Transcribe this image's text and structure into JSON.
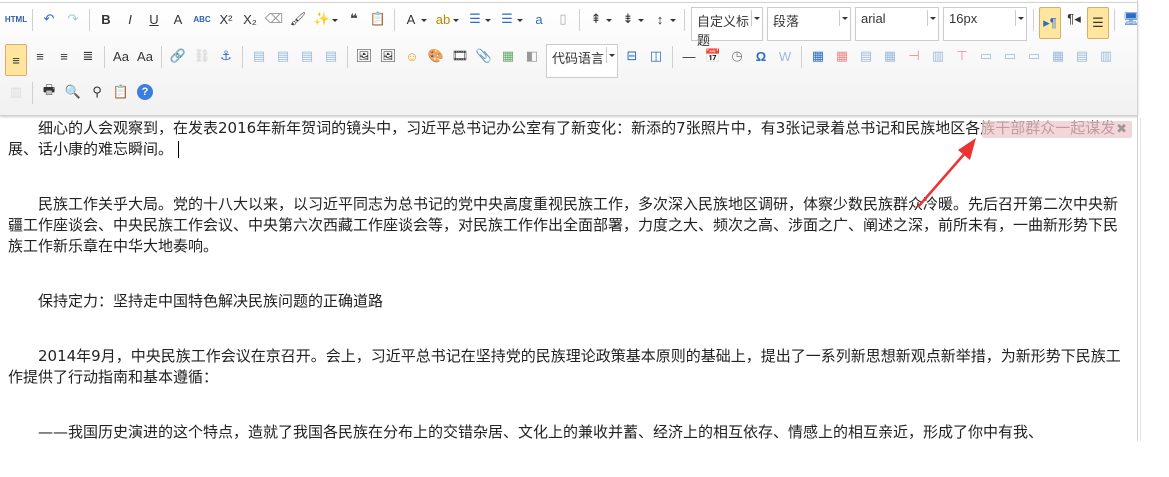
{
  "toolbar": {
    "row1": [
      {
        "icon": "html-source-icon",
        "g": "HTML",
        "small": true
      },
      {
        "sep": 1
      },
      {
        "icon": "undo-icon",
        "g": "↶",
        "c": "#2b6cc4"
      },
      {
        "icon": "redo-icon",
        "g": "↷",
        "c": "#9cc"
      },
      {
        "sep": 1
      },
      {
        "icon": "bold-icon",
        "g": "B",
        "b": 1
      },
      {
        "icon": "italic-icon",
        "g": "I",
        "i": 1
      },
      {
        "icon": "underline-icon",
        "g": "U",
        "u": 1
      },
      {
        "icon": "font-border-icon",
        "g": "A"
      },
      {
        "icon": "strikethrough-icon",
        "g": "ABC",
        "small": true
      },
      {
        "icon": "superscript-icon",
        "g": "X²"
      },
      {
        "icon": "subscript-icon",
        "g": "X₂"
      },
      {
        "icon": "eraser-icon",
        "g": "⌫",
        "c": "#999"
      },
      {
        "icon": "format-brush-icon",
        "g": "🖌"
      },
      {
        "icon": "auto-format-icon",
        "g": "✨",
        "dd": 1
      },
      {
        "icon": "blockquote-icon",
        "g": "❝",
        "b": 1
      },
      {
        "icon": "paste-plain-icon",
        "g": "📋"
      },
      {
        "sep": 1
      },
      {
        "icon": "font-color-icon",
        "g": "A",
        "dd": 1
      },
      {
        "icon": "background-color-icon",
        "g": "ab",
        "dd": 1,
        "c": "#b80"
      },
      {
        "icon": "ordered-list-icon",
        "g": "☰",
        "dd": 1,
        "c": "#2b6cc4"
      },
      {
        "icon": "unordered-list-icon",
        "g": "☰",
        "dd": 1,
        "c": "#2b6cc4"
      },
      {
        "icon": "select-all-icon",
        "g": "a",
        "c": "#2b6cc4"
      },
      {
        "icon": "clear-doc-icon",
        "g": "▯",
        "c": "#aaa"
      },
      {
        "sep": 1
      },
      {
        "icon": "row-spacing-top-icon",
        "g": "⇞",
        "dd": 1
      },
      {
        "icon": "row-spacing-bottom-icon",
        "g": "⇟",
        "dd": 1
      },
      {
        "icon": "line-height-icon",
        "g": "↕",
        "dd": 1
      }
    ],
    "row2": [
      {
        "icon": "align-left-icon",
        "g": "≡",
        "on": 1
      },
      {
        "icon": "align-center-icon",
        "g": "≡"
      },
      {
        "icon": "align-right-icon",
        "g": "≡"
      },
      {
        "icon": "align-justify-icon",
        "g": "≣"
      },
      {
        "sep": 1
      },
      {
        "icon": "to-uppercase-icon",
        "g": "Aa"
      },
      {
        "icon": "to-lowercase-icon",
        "g": "Aa"
      },
      {
        "sep": 1
      },
      {
        "icon": "link-icon",
        "g": "🔗"
      },
      {
        "icon": "unlink-icon",
        "g": "⛓",
        "c": "#ccc"
      },
      {
        "icon": "anchor-icon",
        "g": "⚓",
        "c": "#2b6cc4"
      },
      {
        "sep": 1
      },
      {
        "icon": "image-none-icon",
        "g": "▤",
        "c": "#9bd"
      },
      {
        "icon": "image-left-icon",
        "g": "▤",
        "c": "#9bd"
      },
      {
        "icon": "image-right-icon",
        "g": "▤",
        "c": "#9bd"
      },
      {
        "icon": "image-center-icon",
        "g": "▤",
        "c": "#9bd"
      },
      {
        "sep": 1
      },
      {
        "icon": "simple-upload-icon",
        "g": "🖼"
      },
      {
        "icon": "insert-image-icon",
        "g": "🖼"
      },
      {
        "icon": "emotion-icon",
        "g": "☺",
        "c": "#e90"
      },
      {
        "icon": "scrawl-icon",
        "g": "🎨"
      },
      {
        "icon": "insert-video-icon",
        "g": "🎞"
      },
      {
        "icon": "attachment-icon",
        "g": "📎"
      },
      {
        "icon": "map-icon",
        "g": "▦",
        "c": "#6a6"
      },
      {
        "icon": "insert-frame-icon",
        "g": "◧",
        "c": "#999"
      },
      {
        "combo": "代码语言",
        "name": "code-language-select",
        "w": 60
      },
      {
        "icon": "page-break-icon",
        "g": "⊟",
        "c": "#2b6cc4"
      },
      {
        "icon": "template-icon",
        "g": "◫",
        "c": "#2b6cc4"
      },
      {
        "sep": 1
      },
      {
        "icon": "horizontal-rule-icon",
        "g": "—"
      },
      {
        "icon": "date-icon",
        "g": "📅"
      },
      {
        "icon": "time-icon",
        "g": "◷",
        "c": "#777"
      },
      {
        "icon": "special-chars-icon",
        "g": "Ω",
        "c": "#2b6cc4",
        "b": 1
      },
      {
        "icon": "word-image-icon",
        "g": "W",
        "c": "#9bd"
      },
      {
        "sep": 1
      },
      {
        "icon": "insert-table-icon",
        "g": "▦",
        "c": "#2b6cc4"
      },
      {
        "icon": "delete-table-icon",
        "g": "▦",
        "c": "#e88"
      },
      {
        "icon": "insert-paragraph-before-table-icon",
        "g": "▤",
        "c": "#9bd"
      },
      {
        "icon": "insert-row-icon",
        "g": "▦",
        "c": "#9bd"
      },
      {
        "icon": "delete-row-icon",
        "g": "⊣",
        "c": "#e88"
      },
      {
        "icon": "insert-col-icon",
        "g": "▥",
        "c": "#9bd"
      },
      {
        "icon": "delete-col-icon",
        "g": "⊤",
        "c": "#e88"
      },
      {
        "icon": "merge-cells-icon",
        "g": "▭",
        "c": "#9bd"
      },
      {
        "icon": "merge-right-icon",
        "g": "▭",
        "c": "#9bd"
      },
      {
        "icon": "merge-down-icon",
        "g": "▭",
        "c": "#9bd"
      },
      {
        "icon": "split-to-cells-icon",
        "g": "▦",
        "c": "#9bd"
      },
      {
        "icon": "split-to-rows-icon",
        "g": "▤",
        "c": "#9bd"
      },
      {
        "icon": "split-to-cols-icon",
        "g": "▥",
        "c": "#9bd"
      }
    ],
    "row3": [
      {
        "icon": "charts-icon",
        "g": "▥",
        "c": "#ddd"
      },
      {
        "sep": 1
      },
      {
        "icon": "print-icon",
        "g": "🖶"
      },
      {
        "icon": "preview-icon",
        "g": "🔍"
      },
      {
        "icon": "search-replace-icon",
        "g": "⚲"
      },
      {
        "icon": "drafts-icon",
        "g": "📋"
      },
      {
        "icon": "help-icon",
        "g": "?",
        "c": "#fff",
        "bg": "#3a7fe0"
      }
    ],
    "combos": [
      {
        "name": "custom-heading-select",
        "label": "自定义标题",
        "w": 60
      },
      {
        "name": "paragraph-select",
        "label": "段落",
        "w": 72
      },
      {
        "name": "font-family-select",
        "label": "arial",
        "w": 72
      },
      {
        "name": "font-size-select",
        "label": "16px",
        "w": 72
      }
    ],
    "row1_tail": [
      {
        "icon": "ltr-direction-icon",
        "g": "▸¶",
        "on": 1,
        "c": "#2b6cc4"
      },
      {
        "icon": "rtl-direction-icon",
        "g": "¶◂"
      },
      {
        "icon": "indent-icon",
        "g": "☰",
        "on": 1
      },
      {
        "sep": 1
      },
      {
        "icon": "fullscreen-icon",
        "g": "🖥",
        "c": "#2b6cc4"
      }
    ]
  },
  "content": {
    "paragraphs": [
      "细心的人会观察到，在发表2016年新年贺词的镜头中，习近平总书记办公室有了新变化：新添的7张照片中，有3张记录着总书记和民族地区各族干部群众一起谋发展、话小康的难忘瞬间。",
      "民族工作关乎大局。党的十八大以来，以习近平同志为总书记的党中央高度重视民族工作，多次深入民族地区调研，体察少数民族群众冷暖。先后召开第二次中央新疆工作座谈会、中央民族工作会议、中央第六次西藏工作座谈会等，对民族工作作出全面部署，力度之大、频次之高、涉面之广、阐述之深，前所未有，一曲新形势下民族工作新乐章在中华大地奏响。",
      "保持定力：坚持走中国特色解决民族问题的正确道路",
      "2014年9月，中央民族工作会议在京召开。会上，习近平总书记在坚持党的民族理论政策基本原则的基础上，提出了一系列新思想新观点新举措，为新形势下民族工作提供了行动指南和基本遵循：",
      "——我国历史演进的这个特点，造就了我国各民族在分布上的交错杂居、文化上的兼收并蓄、经济上的相互依存、情感上的相互亲近，形成了你中有我、"
    ]
  },
  "tip": {
    "close": "✖"
  }
}
